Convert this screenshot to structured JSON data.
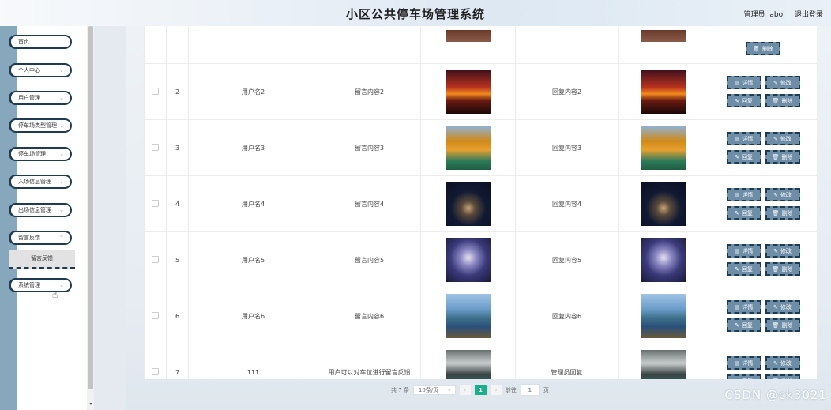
{
  "header": {
    "title": "小区公共停车场管理系统",
    "user_role": "管理员",
    "username": "abo",
    "logout": "退出登录"
  },
  "sidebar": {
    "items": [
      {
        "label": "首页"
      },
      {
        "label": "个人中心"
      },
      {
        "label": "用户管理"
      },
      {
        "label": "停车场类型管理"
      },
      {
        "label": "停车场管理"
      },
      {
        "label": "入场信息管理"
      },
      {
        "label": "出场信息管理"
      },
      {
        "label": "留言反馈"
      },
      {
        "label": "系统管理"
      }
    ],
    "sub_item": "留言反馈"
  },
  "table": {
    "rows": [
      {
        "index": "2",
        "username": "用户名2",
        "message": "留言内容2",
        "reply": "回复内容2",
        "image": "sunset-image"
      },
      {
        "index": "3",
        "username": "用户名3",
        "message": "留言内容3",
        "reply": "回复内容3",
        "image": "autumn-image"
      },
      {
        "index": "4",
        "username": "用户名4",
        "message": "留言内容4",
        "reply": "回复内容4",
        "image": "night-image"
      },
      {
        "index": "5",
        "username": "用户名5",
        "message": "留言内容5",
        "reply": "回复内容5",
        "image": "galaxy-image"
      },
      {
        "index": "6",
        "username": "用户名6",
        "message": "留言内容6",
        "reply": "回复内容6",
        "image": "lake-image"
      },
      {
        "index": "7",
        "username": "111",
        "message": "用户可以对车位进行留言反馈",
        "reply": "管理员回复",
        "image": "garage-image"
      }
    ],
    "ops": {
      "detail": "详情",
      "edit": "修改",
      "reply": "回复",
      "delete": "删除"
    }
  },
  "pagination": {
    "total": "共 7 条",
    "page_size": "10条/页",
    "current_page": "1",
    "goto_prefix": "前往",
    "goto_value": "1",
    "goto_suffix": "页"
  },
  "watermark": "CSDN @ck3021",
  "colors": {
    "sidebar_rail": "#87a7bd",
    "button_bg": "#6e8ea8",
    "button_border": "#1f3b52",
    "page_active": "#1aaf8c"
  }
}
